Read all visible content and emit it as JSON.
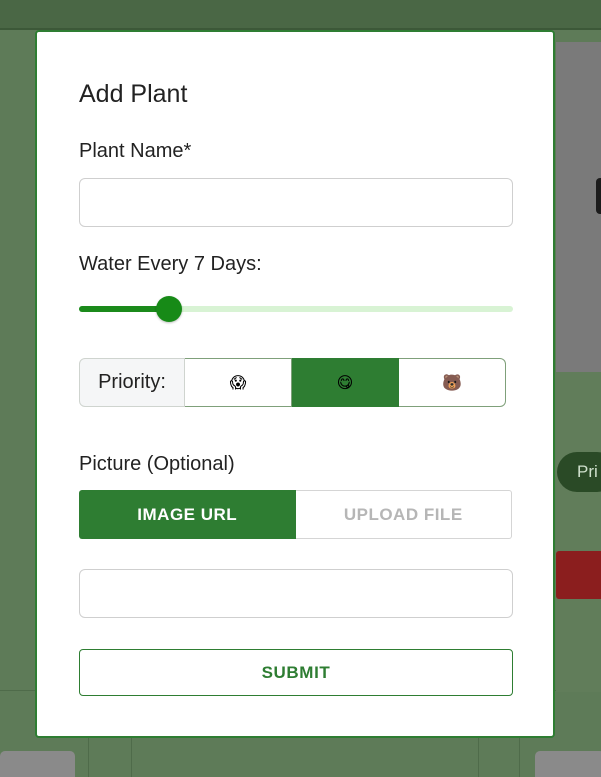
{
  "background": {
    "side_pill_label": "Pri"
  },
  "modal": {
    "title": "Add Plant",
    "plant_name": {
      "label": "Plant Name*",
      "value": ""
    },
    "water": {
      "label": "Water Every 7 Days:",
      "value_days": 7,
      "slider_fraction": 0.207
    },
    "priority": {
      "label": "Priority:",
      "options": [
        {
          "icon": "scared-face-icon",
          "glyph": "😱",
          "selected": false
        },
        {
          "icon": "yum-face-icon",
          "glyph": "😋",
          "selected": true
        },
        {
          "icon": "bear-face-icon",
          "glyph": "🐻",
          "selected": false
        }
      ]
    },
    "picture": {
      "label": "Picture (Optional)",
      "tabs": [
        {
          "label": "IMAGE URL",
          "selected": true
        },
        {
          "label": "UPLOAD FILE",
          "selected": false
        }
      ],
      "url_value": ""
    },
    "submit_label": "SUBMIT"
  },
  "colors": {
    "accent": "#2e7d32",
    "slider": "#1b8a1b",
    "slider_rail": "#d8f3d4"
  }
}
